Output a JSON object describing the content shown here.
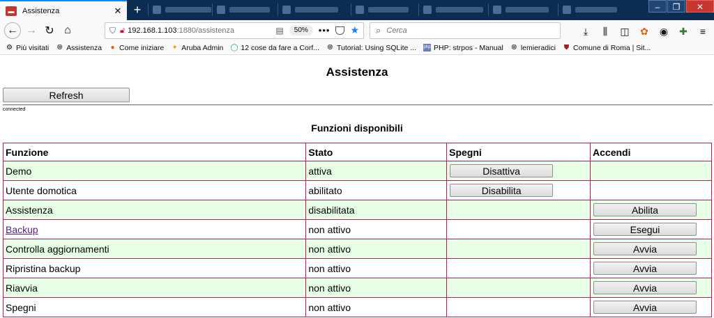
{
  "browser": {
    "tab_title": "Assistenza",
    "url_host": "192.168.1.103",
    "url_path": ":1880/assistenza",
    "zoom": "50%",
    "search_placeholder": "Cerca"
  },
  "bookmarks": [
    {
      "label": "Più visitati",
      "icon": "gear-icon"
    },
    {
      "label": "Assistenza",
      "icon": "globe-icon"
    },
    {
      "label": "Come iniziare",
      "icon": "firefox-icon"
    },
    {
      "label": "Aruba Admin",
      "icon": "star-icon"
    },
    {
      "label": "12 cose da fare a Corf...",
      "icon": "circle-icon"
    },
    {
      "label": "Tutorial: Using SQLite ...",
      "icon": "globe-icon"
    },
    {
      "label": "PHP: strpos - Manual",
      "icon": "php-icon"
    },
    {
      "label": "lemieradici",
      "icon": "globe-icon"
    },
    {
      "label": "Comune di Roma | Sit...",
      "icon": "shield-icon"
    }
  ],
  "page": {
    "title": "Assistenza",
    "refresh_label": "Refresh",
    "connection_status": "connected",
    "section_title": "Funzioni disponibili"
  },
  "table": {
    "headers": [
      "Funzione",
      "Stato",
      "Spegni",
      "Accendi"
    ],
    "rows": [
      {
        "funzione": "Demo",
        "stato": "attiva",
        "spegni": "Disattiva",
        "accendi": ""
      },
      {
        "funzione": "Utente domotica",
        "stato": "abilitato",
        "spegni": "Disabilita",
        "accendi": ""
      },
      {
        "funzione": "Assistenza",
        "stato": "disabilitata",
        "spegni": "",
        "accendi": "Abilita"
      },
      {
        "funzione": "Backup",
        "stato": "non attivo",
        "spegni": "",
        "accendi": "Esegui"
      },
      {
        "funzione": "Controlla aggiornamenti",
        "stato": "non attivo",
        "spegni": "",
        "accendi": "Avvia"
      },
      {
        "funzione": "Ripristina backup",
        "stato": "non attivo",
        "spegni": "",
        "accendi": "Avvia"
      },
      {
        "funzione": "Riavvia",
        "stato": "non attivo",
        "spegni": "",
        "accendi": "Avvia"
      },
      {
        "funzione": "Spegni",
        "stato": "non attivo",
        "spegni": "",
        "accendi": "Avvia"
      }
    ]
  },
  "colors": {
    "row_alt": "#e6ffe6",
    "table_border": "#c2185b",
    "link": "#551a8b",
    "tabbar": "#0c2d52"
  }
}
